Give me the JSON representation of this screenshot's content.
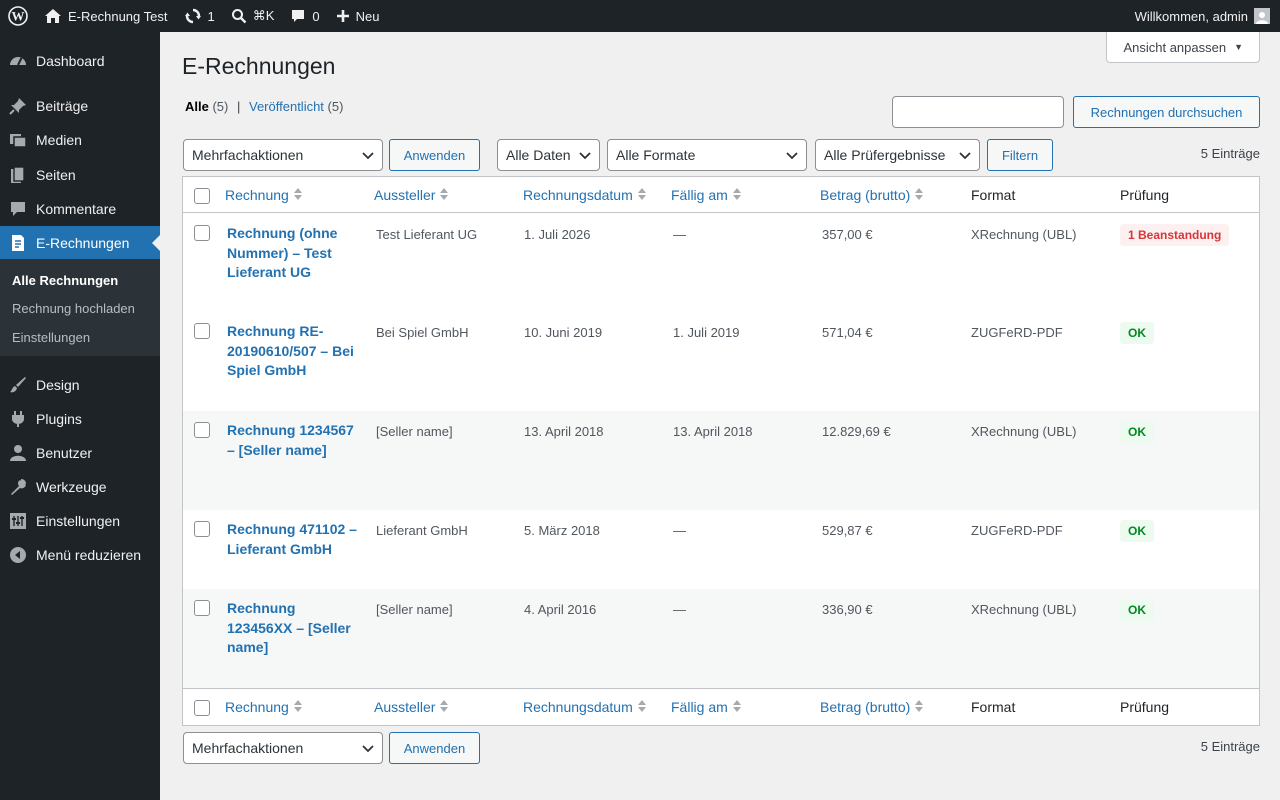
{
  "adminbar": {
    "site_name": "E-Rechnung Test",
    "updates_count": "1",
    "search_shortcut": "⌘K",
    "comments_count": "0",
    "new_label": "Neu",
    "greeting": "Willkommen, admin"
  },
  "sidebar": {
    "items": [
      {
        "label": "Dashboard",
        "icon": "dashboard-icon"
      },
      {
        "label": "Beiträge",
        "icon": "pin-icon"
      },
      {
        "label": "Medien",
        "icon": "media-icon"
      },
      {
        "label": "Seiten",
        "icon": "pages-icon"
      },
      {
        "label": "Kommentare",
        "icon": "comments-icon"
      },
      {
        "label": "E-Rechnungen",
        "icon": "invoice-icon"
      },
      {
        "label": "Design",
        "icon": "brush-icon"
      },
      {
        "label": "Plugins",
        "icon": "plugin-icon"
      },
      {
        "label": "Benutzer",
        "icon": "user-icon"
      },
      {
        "label": "Werkzeuge",
        "icon": "wrench-icon"
      },
      {
        "label": "Einstellungen",
        "icon": "settings-icon"
      },
      {
        "label": "Menü reduzieren",
        "icon": "collapse-icon"
      }
    ],
    "submenu": [
      "Alle Rechnungen",
      "Rechnung hochladen",
      "Einstellungen"
    ]
  },
  "screen_options": "Ansicht anpassen",
  "page_title": "E-Rechnungen",
  "views": {
    "all_label": "Alle",
    "all_count": "(5)",
    "sep": "|",
    "published_label": "Veröffentlicht",
    "published_count": "(5)"
  },
  "search": {
    "placeholder": "",
    "button": "Rechnungen durchsuchen"
  },
  "filters": {
    "bulk_action": "Mehrfachaktionen",
    "apply": "Anwenden",
    "dates": "Alle Daten",
    "formats": "Alle Formate",
    "checks": "Alle Prüfergebnisse",
    "filter_button": "Filtern"
  },
  "items_count": "5 Einträge",
  "table": {
    "columns": [
      "Rechnung",
      "Aussteller",
      "Rechnungsdatum",
      "Fällig am",
      "Betrag (brutto)",
      "Format",
      "Prüfung"
    ],
    "rows": [
      {
        "title": "Rechnung (ohne Nummer) – Test Lieferant UG",
        "issuer": "Test Lieferant UG",
        "date": "1. Juli 2026",
        "due": "—",
        "amount": "357,00 €",
        "format": "XRechnung (UBL)",
        "check": "1 Beanstandung",
        "status": "error"
      },
      {
        "title": "Rechnung RE-20190610/507 – Bei Spiel GmbH",
        "issuer": "Bei Spiel GmbH",
        "date": "10. Juni 2019",
        "due": "1. Juli 2019",
        "amount": "571,04 €",
        "format": "ZUGFeRD-PDF",
        "check": "OK",
        "status": "ok"
      },
      {
        "title": "Rechnung 1234567 – [Seller name]",
        "issuer": "[Seller name]",
        "date": "13. April 2018",
        "due": "13. April 2018",
        "amount": "12.829,69 €",
        "format": "XRechnung (UBL)",
        "check": "OK",
        "status": "ok"
      },
      {
        "title": "Rechnung 471102 – Lieferant GmbH",
        "issuer": "Lieferant GmbH",
        "date": "5. März 2018",
        "due": "—",
        "amount": "529,87 €",
        "format": "ZUGFeRD-PDF",
        "check": "OK",
        "status": "ok"
      },
      {
        "title": "Rechnung 123456XX – [Seller name]",
        "issuer": "[Seller name]",
        "date": "4. April 2016",
        "due": "—",
        "amount": "336,90 €",
        "format": "XRechnung (UBL)",
        "check": "OK",
        "status": "ok"
      }
    ]
  },
  "colors": {
    "accent": "#2271b1",
    "menu_bg": "#1d2327",
    "error": "#d63638",
    "ok": "#008a20"
  }
}
